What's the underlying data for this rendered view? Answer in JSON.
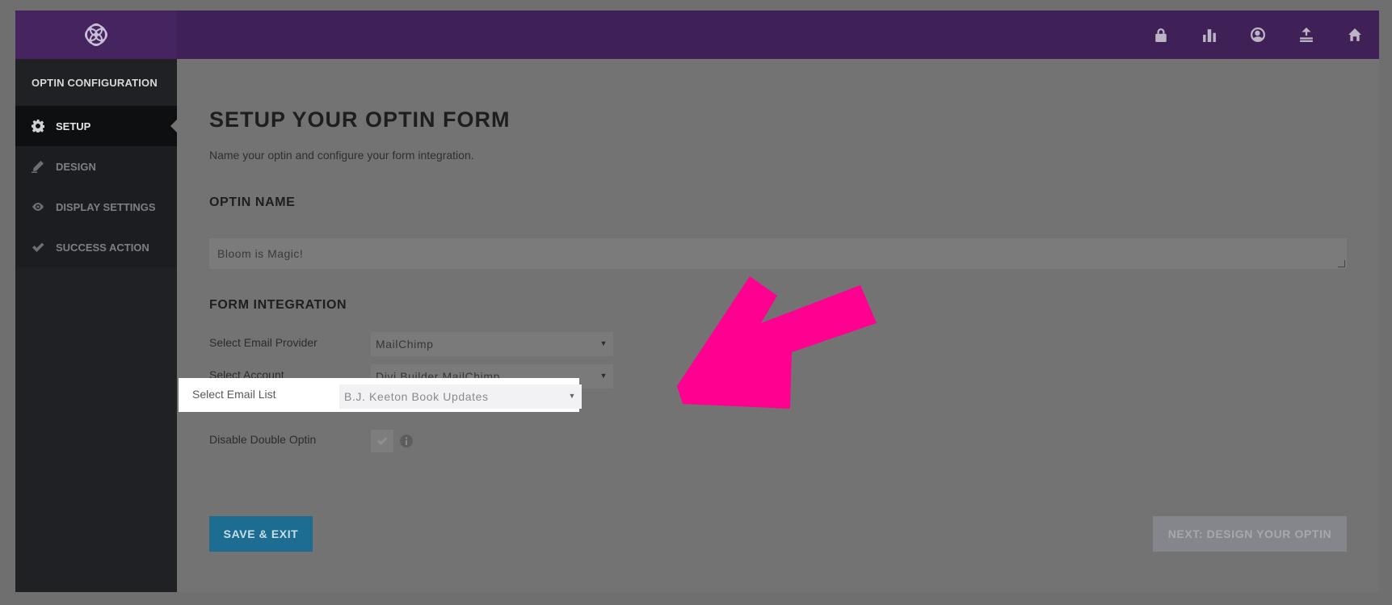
{
  "sidebar": {
    "header": "OPTIN CONFIGURATION",
    "items": [
      {
        "label": "SETUP",
        "icon": "gear-icon"
      },
      {
        "label": "DESIGN",
        "icon": "pencil-icon"
      },
      {
        "label": "DISPLAY SETTINGS",
        "icon": "eye-icon"
      },
      {
        "label": "SUCCESS ACTION",
        "icon": "check-icon"
      }
    ]
  },
  "topbar": {
    "icons": [
      "lock-icon",
      "bar-chart-icon",
      "user-circle-icon",
      "import-export-icon",
      "home-icon"
    ]
  },
  "main": {
    "title": "SETUP YOUR OPTIN FORM",
    "subtitle": "Name your optin and configure your form integration.",
    "optin_name_title": "OPTIN NAME",
    "optin_name_value": "Bloom is Magic!",
    "form_integration_title": "FORM INTEGRATION",
    "rows": [
      {
        "label": "Select Email Provider",
        "value": "MailChimp"
      },
      {
        "label": "Select Account",
        "value": "Divi Builder MailChimp"
      },
      {
        "label": "Select Email List",
        "value": "B.J. Keeton Book Updates"
      },
      {
        "label": "Disable Double Optin"
      }
    ],
    "save_button": "SAVE & EXIT",
    "next_button": "NEXT: DESIGN YOUR OPTIN"
  },
  "colors": {
    "topbar": "#3f2158",
    "sidebar": "#1f2124",
    "save_button": "#1d6d92",
    "annotation_arrow": "#ff0090"
  }
}
